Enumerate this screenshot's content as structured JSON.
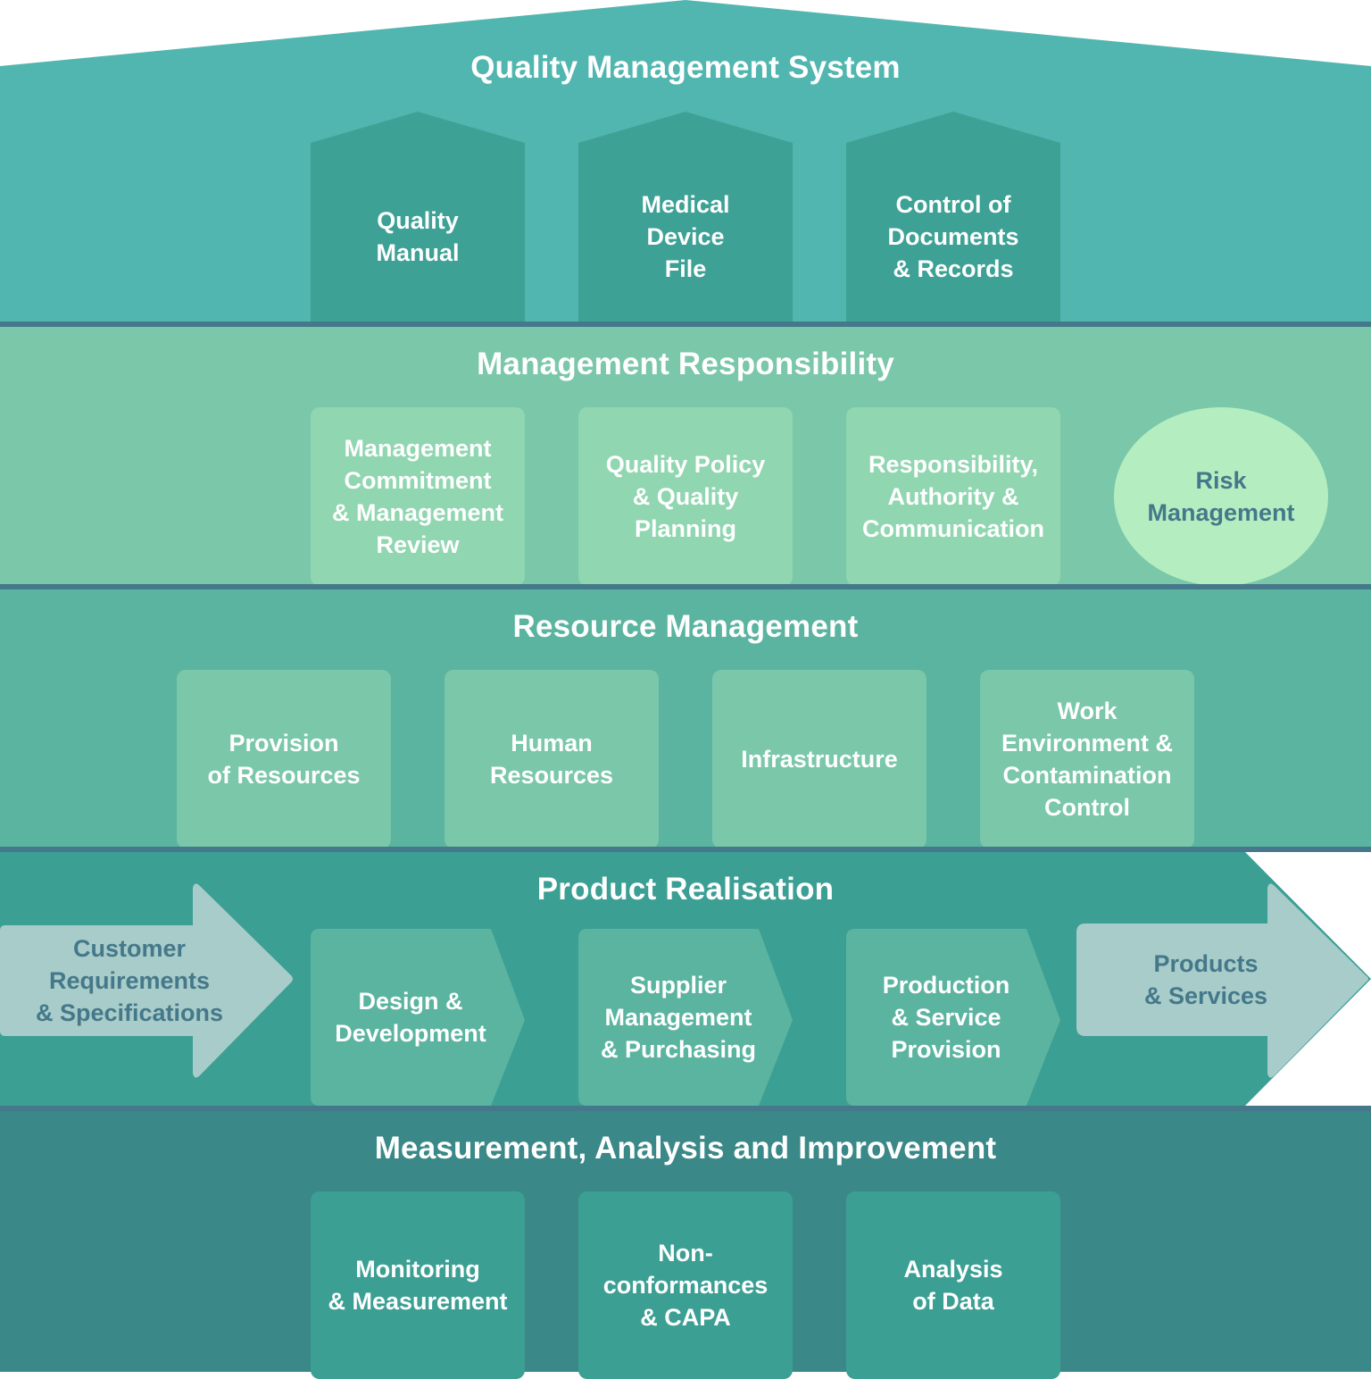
{
  "colors": {
    "qms_bg": "#52b6b0",
    "qms_box": "#3da195",
    "mgmt_bg": "#7ac7a9",
    "mgmt_box": "#90d6b0",
    "risk_bg": "#b4eec0",
    "resource_bg": "#5ab4a0",
    "resource_box": "#7ac7aa",
    "product_bg": "#3b9f94",
    "product_box": "#5bb4a0",
    "arrow_bg": "#a7ccc9",
    "measure_bg": "#3a8888",
    "measure_box": "#3c9f94",
    "divider": "#45788a",
    "dark_text": "#45788a"
  },
  "sections": {
    "qms": {
      "title": "Quality Management System",
      "items": [
        "Quality\nManual",
        "Medical\nDevice\nFile",
        "Control of\nDocuments\n& Records"
      ]
    },
    "management": {
      "title": "Management Responsibility",
      "items": [
        "Management\nCommitment\n& Management\nReview",
        "Quality Policy\n& Quality\nPlanning",
        "Responsibility,\nAuthority &\nCommunication"
      ],
      "highlight": "Risk\nManagement"
    },
    "resource": {
      "title": "Resource Management",
      "items": [
        "Provision\nof Resources",
        "Human\nResources",
        "Infrastructure",
        "Work\nEnvironment &\nContamination\nControl"
      ]
    },
    "product": {
      "title": "Product Realisation",
      "input": "Customer\nRequirements\n& Specifications",
      "steps": [
        "Design &\nDevelopment",
        "Supplier\nManagement\n& Purchasing",
        "Production\n& Service\nProvision"
      ],
      "output": "Products\n& Services"
    },
    "measurement": {
      "title": "Measurement, Analysis and Improvement",
      "items": [
        "Monitoring\n& Measurement",
        "Non-\nconformances\n& CAPA",
        "Analysis\nof Data"
      ]
    }
  }
}
